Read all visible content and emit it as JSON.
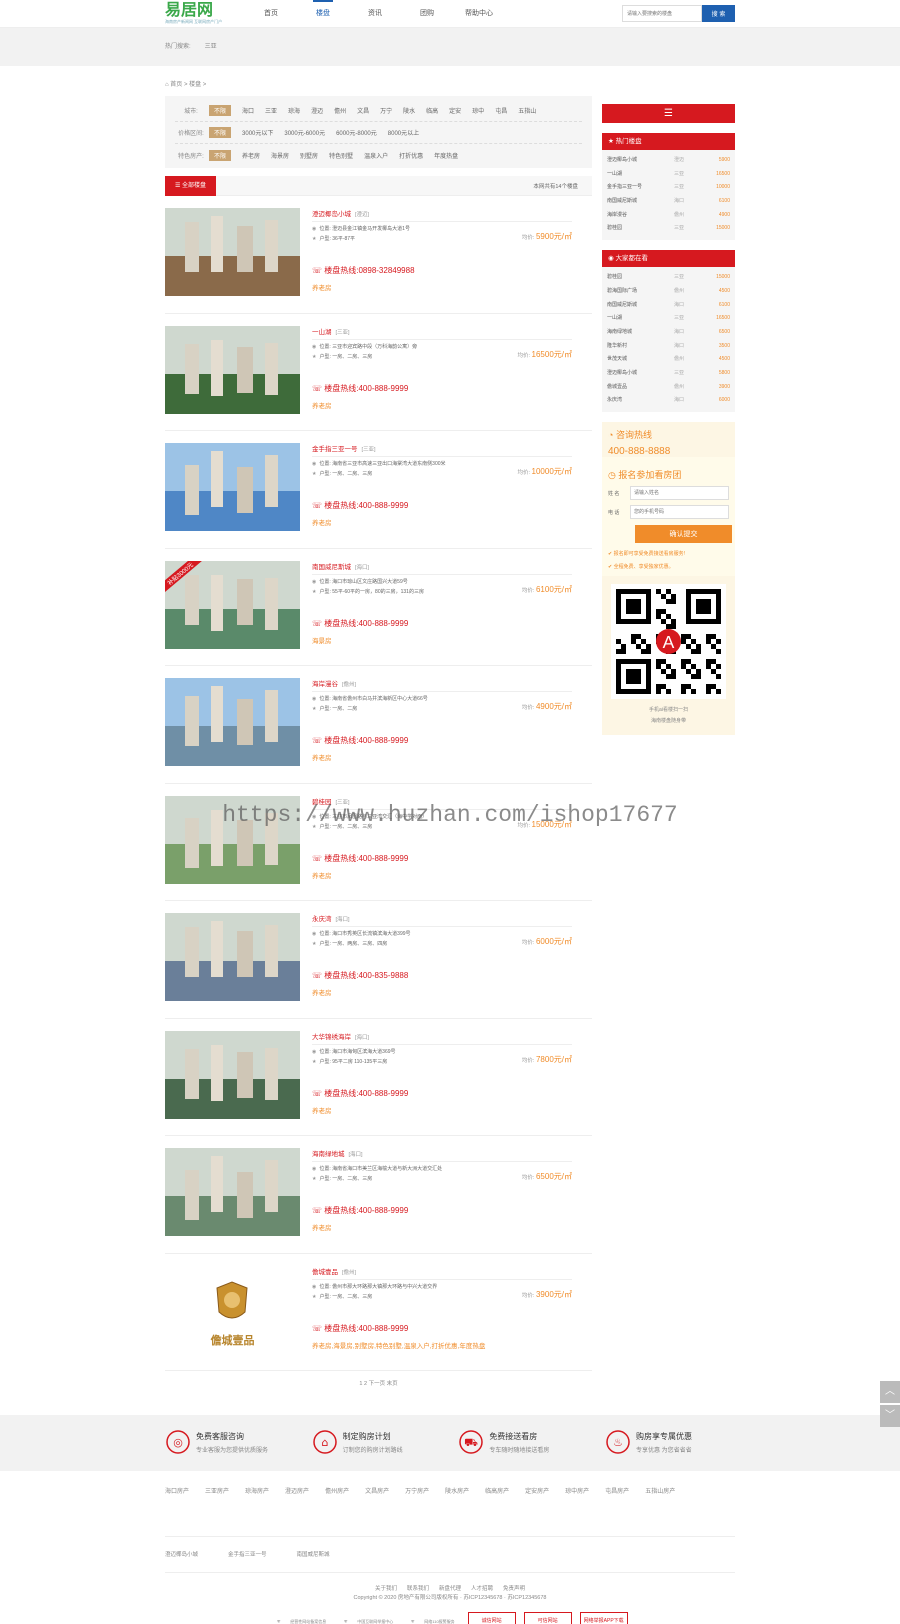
{
  "header": {
    "logo": "易居网",
    "logo_sub": "海南房产新闻网 互联网房产门户",
    "nav": [
      "首页",
      "楼盘",
      "资讯",
      "团购",
      "帮助中心"
    ],
    "search_placeholder": "请输入要搜索的楼盘",
    "search_btn": "搜 索"
  },
  "hot": {
    "label": "热门搜索:",
    "items": [
      "三亚"
    ]
  },
  "breadcrumb": "首页 > 楼盘 >",
  "filter": {
    "rows": [
      {
        "label": "城市:",
        "all": "不限",
        "opts": [
          "海口",
          "三亚",
          "琼海",
          "澄迈",
          "儋州",
          "文昌",
          "万宁",
          "陵水",
          "临高",
          "定安",
          "琼中",
          "屯昌",
          "五指山"
        ]
      },
      {
        "label": "价格区间:",
        "all": "不限",
        "opts": [
          "3000元以下",
          "3000元-6000元",
          "6000元-8000元",
          "8000元以上"
        ]
      },
      {
        "label": "特色房产:",
        "all": "不限",
        "opts": [
          "养老房",
          "海景房",
          "别墅房",
          "特色别墅",
          "温泉入户",
          "打折优惠",
          "年度热盘"
        ]
      }
    ]
  },
  "list": {
    "tab": "☰ 全部楼盘",
    "count": "本网共有14个楼盘",
    "addr_label": "位置:",
    "type_label": "户型:",
    "price_label": "均价:",
    "unit": "元/㎡",
    "tel_label": "楼盘热线:",
    "items": [
      {
        "name": "澄迈椰岛小城",
        "area": "[澄迈]",
        "addr": "澄迈县金江镇金马开发椰岛大道1号",
        "type": "36平-87平",
        "price": "5900",
        "tel": "0898-32849988",
        "tag": "养老房",
        "color": "#8a6a4a"
      },
      {
        "name": "一山湖",
        "area": "[三亚]",
        "addr": "三亚市迎宾路中段（万科海韵公寓）旁",
        "type": "一房、二房、三房",
        "price": "16500",
        "tel": "400-888-9999",
        "tag": "养老房",
        "color": "#3e6b3a"
      },
      {
        "name": "金手指三亚一号",
        "area": "[三亚]",
        "addr": "海南省三亚市高速三亚出口海棠湾大道东南侧300米",
        "type": "一房、二房、三房",
        "price": "10000",
        "tel": "400-888-9999",
        "tag": "养老房",
        "color": "#4f87c6"
      },
      {
        "name": "南国威尼斯城",
        "area": "[海口]",
        "addr": "海口市琼山区文庄路国兴大道59号",
        "type": "55平-60平的一房，80的三房，131的三房",
        "price": "6100",
        "tel": "400-888-9999",
        "tag": "海景房",
        "color": "#5a8a6a"
      },
      {
        "name": "海岸漫谷",
        "area": "[儋州]",
        "addr": "海南省儋州市白马井滨海新区中心大道66号",
        "type": "一房、二房",
        "price": "4900",
        "tel": "400-888-9999",
        "tag": "养老房",
        "color": "#6f8fa6"
      },
      {
        "name": "碧桂园",
        "area": "[三亚]",
        "addr": "三亚市凤凰路与三亚湾交汇（海中学对面）",
        "type": "一房、二房、三房",
        "price": "15000",
        "tel": "400-888-9999",
        "tag": "养老房",
        "color": "#7aa06a"
      },
      {
        "name": "永庆湾",
        "area": "[海口]",
        "addr": "海口市秀英区长流镇滨海大道399号",
        "type": "一房、两房、三房、四房",
        "price": "6000",
        "tel": "400-835-9888",
        "tag": "养老房",
        "color": "#6a7f99"
      },
      {
        "name": "大华锦绣海岸",
        "area": "[海口]",
        "addr": "海口市海甸区滨海大道369号",
        "type": "95平二房 110-135平三房",
        "price": "7800",
        "tel": "400-888-9999",
        "tag": "养老房",
        "color": "#4a6a4f"
      },
      {
        "name": "海南绿地城",
        "area": "[海口]",
        "addr": "海南省海口市美兰区海榆大道与新大洲大道交汇处",
        "type": "一房、二房、三房",
        "price": "6500",
        "tel": "400-888-9999",
        "tag": "养老房",
        "color": "#6a8a6f"
      },
      {
        "name": "儋城壹品",
        "area": "[儋州]",
        "addr": "儋州市那大环路那大镇那大环路与中兴大道交界",
        "type": "一房、二房、三房",
        "price": "3900",
        "tel": "400-888-9999",
        "tag": "养老房,海景房,别墅房,特色别墅,温泉入户,打折优惠,年度热盘",
        "color": "#ffffff"
      }
    ],
    "badge_text": "补贴3000元",
    "logo_text": "儋城壹品",
    "pager": "1 2 下一页 末页"
  },
  "side": {
    "menu": "☰",
    "hot_title": "热门楼盘",
    "hot": [
      [
        "澄迈椰岛小城",
        "澄迈",
        "5900"
      ],
      [
        "一山湖",
        "三亚",
        "16500"
      ],
      [
        "金手指三亚一号",
        "三亚",
        "10000"
      ],
      [
        "南国威尼斯城",
        "海口",
        "6100"
      ],
      [
        "海岸漫谷",
        "儋州",
        "4900"
      ],
      [
        "碧桂园",
        "三亚",
        "15000"
      ]
    ],
    "view_title": "大家都在看",
    "view": [
      [
        "碧桂园",
        "三亚",
        "15000"
      ],
      [
        "碧海国际广场",
        "儋州",
        "4500"
      ],
      [
        "南国威尼斯城",
        "海口",
        "6100"
      ],
      [
        "一山湖",
        "三亚",
        "16500"
      ],
      [
        "海南绿地城",
        "海口",
        "6500"
      ],
      [
        "隆华新村",
        "海口",
        "3500"
      ],
      [
        "世茂天城",
        "儋州",
        "4500"
      ],
      [
        "澄迈椰岛小城",
        "三亚",
        "5800"
      ],
      [
        "儋城壹品",
        "儋州",
        "3900"
      ],
      [
        "永庆湾",
        "海口",
        "6000"
      ]
    ],
    "consult_title": "咨询热线",
    "consult_phone": "400-888-8888",
    "join_title": "报名参加看房团",
    "name_label": "姓 名",
    "name_ph": "请输入姓名",
    "phone_label": "电 话",
    "phone_ph": "您的手机号码",
    "submit": "确认提交",
    "note1": "报名即可享受免费接送看房服务!",
    "note2": "全程免费、享受独家优惠。",
    "qr1": "手机ai看楼扫一扫",
    "qr2": "海南楼盘随身带"
  },
  "features": [
    {
      "t1": "免费客服咨询",
      "t2": "专业客服为您提供优质服务"
    },
    {
      "t1": "制定购房计划",
      "t2": "订制您的购房计划路线"
    },
    {
      "t1": "免费接送看房",
      "t2": "专车随时随地接送看房"
    },
    {
      "t1": "购房享专属优惠",
      "t2": "专享优惠 为您省省省"
    }
  ],
  "city_links": [
    "海口房产",
    "三亚房产",
    "琼海房产",
    "澄迈房产",
    "儋州房产",
    "文昌房产",
    "万宁房产",
    "陵水房产",
    "临高房产",
    "定安房产",
    "琼中房产",
    "屯昌房产",
    "五指山房产"
  ],
  "friend_links": [
    "澄迈椰岛小城",
    "金手指三亚一号",
    "南国威尼斯城"
  ],
  "footer": {
    "links": [
      "关于我们",
      "联系我们",
      "新盘代理",
      "人才招聘",
      "免责声明"
    ],
    "copyright": "Copyright © 2020 房地产有限公司版权所有 · 苏ICP12345678 · 苏ICP12345678",
    "badges": [
      "经营性网站备案信息",
      "中国互联网举报中心",
      "网络110报警服务",
      "诚信网站",
      "可信网站",
      "网络举报APP下载"
    ]
  },
  "watermark": "https://www.huzhan.com/ishop17677",
  "colors": {
    "red": "#d6191f",
    "orange": "#f08c2a",
    "blue": "#1e60b0",
    "green": "#3aa84a"
  }
}
